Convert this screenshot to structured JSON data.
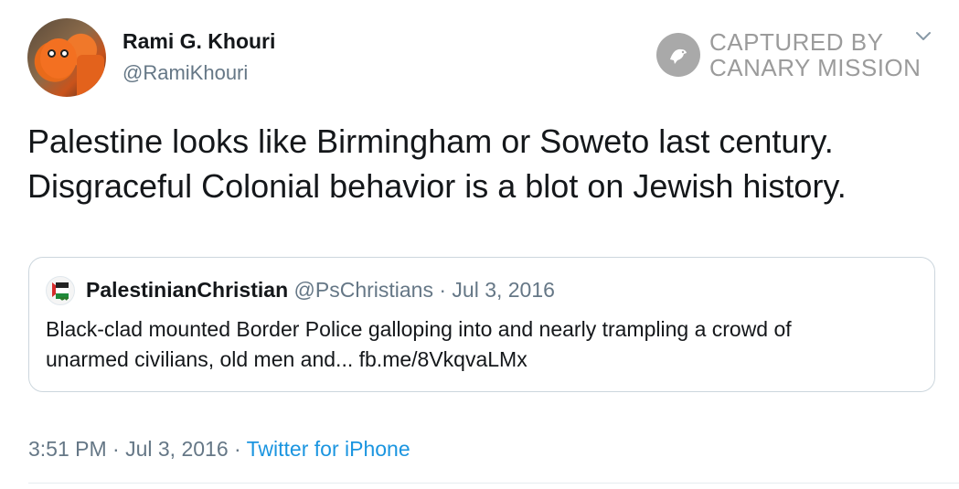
{
  "author": {
    "display_name": "Rami G. Khouri",
    "handle": "@RamiKhouri"
  },
  "watermark": {
    "line1": "CAPTURED BY",
    "line2": "CANARY MISSION",
    "icon": "canary-bird-icon"
  },
  "tweet": {
    "line1": "Palestine looks like Birmingham or Soweto last century.",
    "line2": "Disgraceful Colonial behavior is a blot on Jewish history."
  },
  "quote": {
    "display_name": "PalestinianChristian",
    "meta": "@PsChristians · Jul 3, 2016",
    "line1": "Black-clad mounted Border Police galloping into and nearly trampling a crowd of",
    "line2": "unarmed civilians, old men and... fb.me/8VkqvaLMx"
  },
  "footer": {
    "timestamp": "3:51 PM · Jul 3, 2016 · ",
    "source": "Twitter for iPhone"
  },
  "colors": {
    "link": "#1b95e0",
    "muted": "#657786",
    "border": "#ccd6dd",
    "watermark": "#9b9b9b"
  }
}
